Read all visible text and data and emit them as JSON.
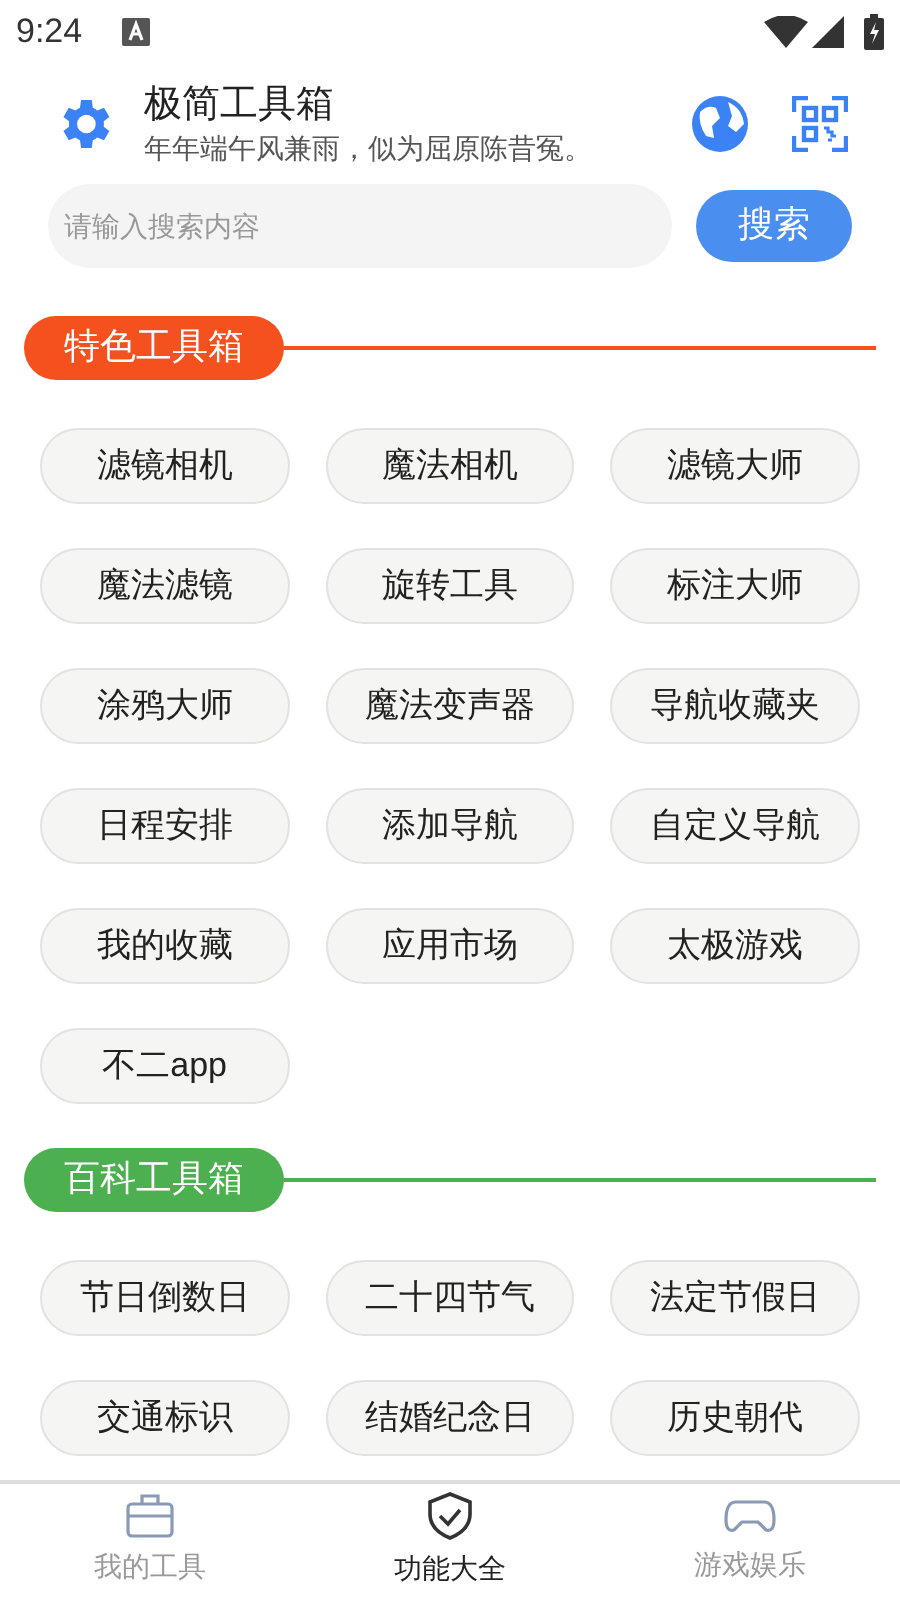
{
  "status_bar": {
    "time": "9:24"
  },
  "header": {
    "title": "极简工具箱",
    "subtitle": "年年端午风兼雨，似为屈原陈昔冤。"
  },
  "search": {
    "placeholder": "请输入搜索内容",
    "button": "搜索"
  },
  "sections": [
    {
      "title": "特色工具箱",
      "color": "#f4511e",
      "items": [
        "滤镜相机",
        "魔法相机",
        "滤镜大师",
        "魔法滤镜",
        "旋转工具",
        "标注大师",
        "涂鸦大师",
        "魔法变声器",
        "导航收藏夹",
        "日程安排",
        "添加导航",
        "自定义导航",
        "我的收藏",
        "应用市场",
        "太极游戏",
        "不二app"
      ]
    },
    {
      "title": "百科工具箱",
      "color": "#4caf50",
      "items": [
        "节日倒数日",
        "二十四节气",
        "法定节假日",
        "交通标识",
        "结婚纪念日",
        "历史朝代"
      ]
    }
  ],
  "tabs": [
    {
      "label": "我的工具",
      "selected": false,
      "kind": "toolbox"
    },
    {
      "label": "功能大全",
      "selected": true,
      "kind": "shield"
    },
    {
      "label": "游戏娱乐",
      "selected": false,
      "kind": "game"
    }
  ]
}
